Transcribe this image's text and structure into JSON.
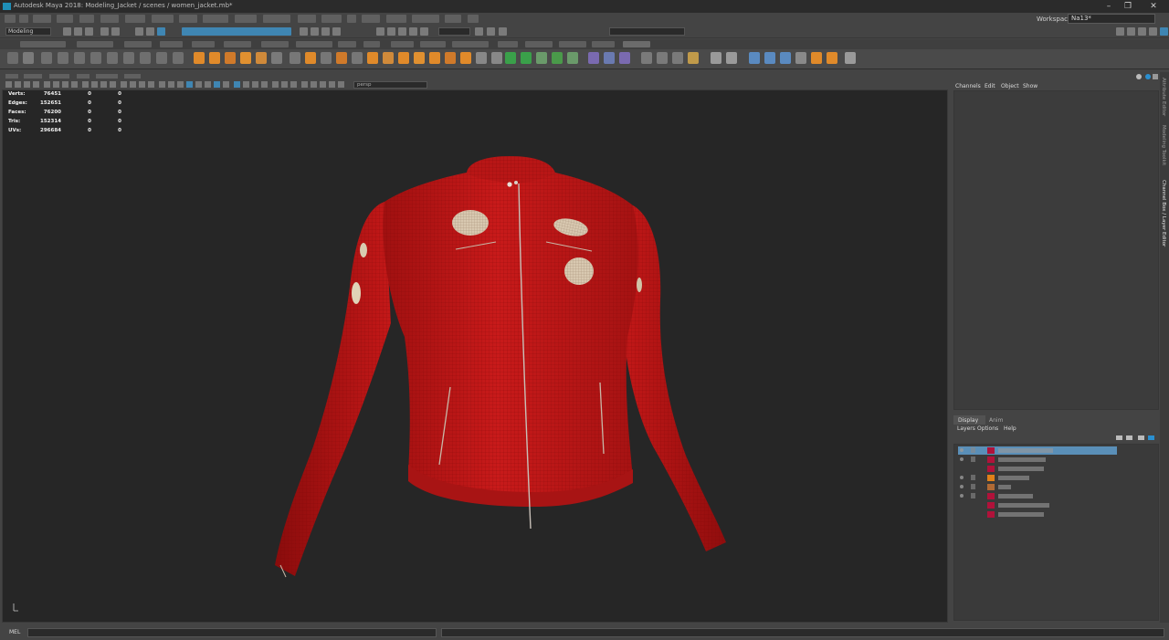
{
  "window": {
    "title": "Autodesk Maya 2018: Modeling_Jacket / scenes / women_jacket.mb*",
    "minimize_icon": "minimize-icon",
    "maximize_icon": "maximize-icon",
    "close_icon": "close-icon"
  },
  "workspace": {
    "label": "Workspace :",
    "value": "Na13*"
  },
  "status_line": {
    "mode": "Modeling"
  },
  "viewport": {
    "panel_selector": "persp",
    "hud": [
      {
        "label": "Verts:",
        "value": "76451",
        "sel": "0",
        "tri": "0"
      },
      {
        "label": "Edges:",
        "value": "152651",
        "sel": "0",
        "tri": "0"
      },
      {
        "label": "Faces:",
        "value": "76200",
        "sel": "0",
        "tri": "0"
      },
      {
        "label": "Tris:",
        "value": "152314",
        "sel": "0",
        "tri": "0"
      },
      {
        "label": "UVs:",
        "value": "296684",
        "sel": "0",
        "tri": "0"
      }
    ]
  },
  "channel_box": {
    "menus": [
      "Channels",
      "Edit",
      "Object",
      "Show"
    ]
  },
  "layer_editor": {
    "tabs": [
      "Display",
      "Anim"
    ],
    "menus": [
      "Layers",
      "Options",
      "Help"
    ],
    "layers": [
      {
        "color": "#b0123a",
        "selected": true,
        "visible": true,
        "name_width": 60
      },
      {
        "color": "#b0123a",
        "selected": false,
        "visible": true,
        "name_width": 52
      },
      {
        "color": "#b0123a",
        "selected": false,
        "visible": false,
        "name_width": 50
      },
      {
        "color": "#e08018",
        "selected": false,
        "visible": true,
        "name_width": 34
      },
      {
        "color": "#b06a34",
        "selected": false,
        "visible": true,
        "name_width": 14
      },
      {
        "color": "#b0123a",
        "selected": false,
        "visible": true,
        "name_width": 38
      },
      {
        "color": "#b0123a",
        "selected": false,
        "visible": false,
        "name_width": 56
      },
      {
        "color": "#b0123a",
        "selected": false,
        "visible": false,
        "name_width": 50
      }
    ]
  },
  "side_tabs": [
    "Attribute Editor",
    "Modeling Toolkit",
    "Channel Box / Layer Editor"
  ],
  "command_line": {
    "label": "MEL"
  },
  "colors": {
    "jacket": "#b01414",
    "viewport_bg": "#262626",
    "selection": "#5a8fb8"
  }
}
